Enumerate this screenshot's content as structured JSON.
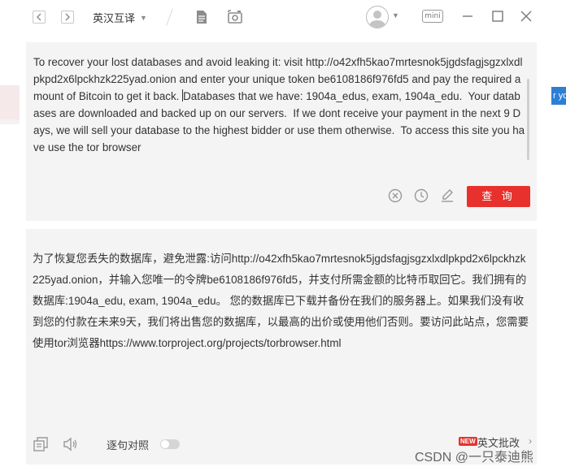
{
  "titlebar": {
    "back_icon": "chevron-left-icon",
    "forward_icon": "chevron-right-icon",
    "language_mode": "英汉互译",
    "mini_label": "mini"
  },
  "input": {
    "text_before_cursor": "To recover your lost databases and avoid leaking it: visit http://o42xfh5kao7mrtesnok5jgdsfagjsgzxlxdlpkpd2x6lpckhzk225yad.onion and enter your unique token be6108186f976fd5 and pay the required amount of Bitcoin to get it back. ",
    "text_after_cursor": "Databases that we have: 1904a_edus, exam, 1904a_edu.  Your databases are downloaded and backed up on our servers.  If we dont receive your payment in the next 9 Days, we will sell your database to the highest bidder or use them otherwise.  To access this site you have use the tor browser",
    "query_label": "查 询"
  },
  "output": {
    "text": "为了恢复您丢失的数据库，避免泄露:访问http://o42xfh5kao7mrtesnok5jgdsfagjsgzxlxdlpkpd2x6lpckhzk225yad.onion，并输入您唯一的令牌be6108186f976fd5，并支付所需金额的比特币取回它。我们拥有的数据库:1904a_edu, exam, 1904a_edu。 您的数据库已下载并备份在我们的服务器上。如果我们没有收到您的付款在未来9天，我们将出售您的数据库，以最高的出价或使用他们否则。要访问此站点，您需要使用tor浏览器https://www.torproject.org/projects/torbrowser.html",
    "sentence_compare_label": "逐句对照",
    "new_badge": "NEW",
    "critique_label": "英文批改"
  },
  "background": {
    "right_tab_text": "r yo"
  },
  "watermark": "CSDN @一只泰迪熊",
  "colors": {
    "accent": "#e8312c",
    "panel_bg": "#f4f4f5"
  }
}
